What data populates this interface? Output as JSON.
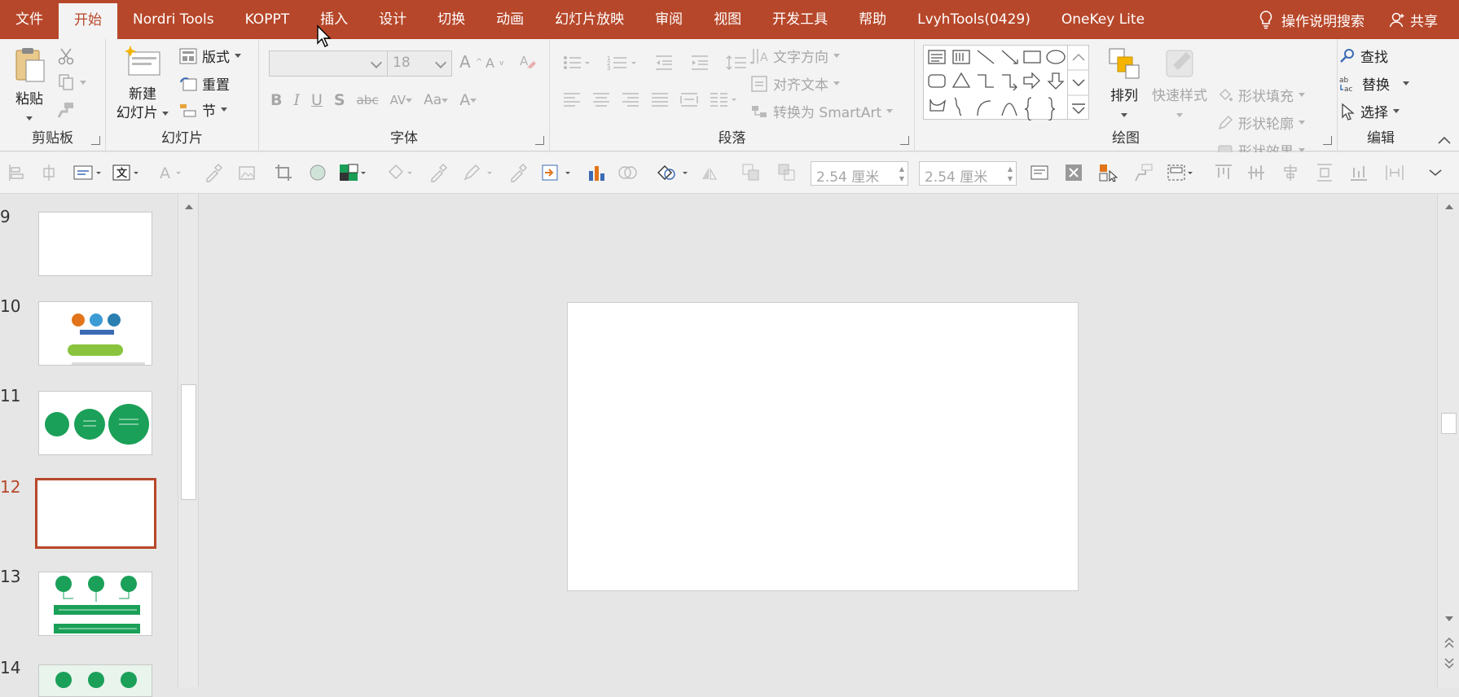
{
  "menu": {
    "tabs": [
      "文件",
      "开始",
      "Nordri Tools",
      "KOPPT",
      "插入",
      "设计",
      "切换",
      "动画",
      "幻灯片放映",
      "审阅",
      "视图",
      "开发工具",
      "帮助",
      "LvyhTools(0429)",
      "OneKey Lite"
    ],
    "active_tab": "开始",
    "tell_me": "操作说明搜索",
    "share": "共享"
  },
  "ribbon": {
    "clipboard": {
      "label": "剪贴板",
      "paste": "粘贴"
    },
    "slides": {
      "label": "幻灯片",
      "new_slide_line1": "新建",
      "new_slide_line2": "幻灯片",
      "layout": "版式",
      "reset": "重置",
      "section": "节"
    },
    "font": {
      "label": "字体",
      "font_name": "",
      "font_size": "18"
    },
    "paragraph": {
      "label": "段落",
      "text_direction": "文字方向",
      "align_text": "对齐文本",
      "convert_smartart": "转换为 SmartArt"
    },
    "drawing": {
      "label": "绘图",
      "arrange": "排列",
      "quick_styles": "快速样式",
      "shape_fill": "形状填充",
      "shape_outline": "形状轮廓",
      "shape_effects": "形状效果"
    },
    "editing": {
      "label": "编辑",
      "find": "查找",
      "replace": "替换",
      "select": "选择"
    }
  },
  "quick_toolbar": {
    "height_value": "2.54 厘米",
    "width_value": "2.54 厘米"
  },
  "slides_pane": {
    "slides": [
      {
        "number": "9"
      },
      {
        "number": "10"
      },
      {
        "number": "11"
      },
      {
        "number": "12",
        "selected": true
      },
      {
        "number": "13"
      },
      {
        "number": "14"
      }
    ]
  },
  "colors": {
    "accent": "#b7472a",
    "ribbon_bg": "#f3f3f3",
    "workspace_bg": "#e6e6e6",
    "thumb_green": "#1aa058"
  }
}
